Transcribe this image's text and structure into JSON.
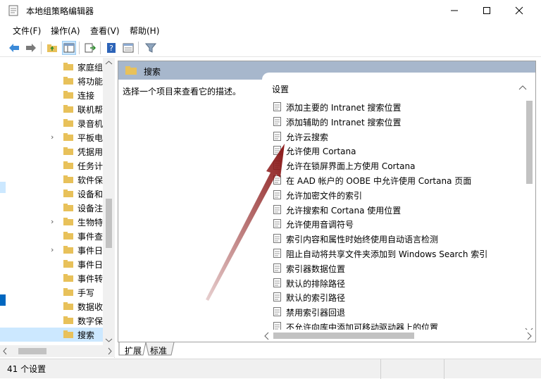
{
  "window": {
    "title": "本地组策略编辑器",
    "controls": {
      "minimize": "—",
      "maximize": "☐",
      "close": "✕"
    }
  },
  "menu": [
    "文件(F)",
    "操作(A)",
    "查看(V)",
    "帮助(H)"
  ],
  "tree": {
    "items": [
      {
        "label": "家庭组",
        "expandable": false
      },
      {
        "label": "将功能",
        "expandable": false
      },
      {
        "label": "连接",
        "expandable": false
      },
      {
        "label": "联机帮",
        "expandable": false
      },
      {
        "label": "录音机",
        "expandable": false
      },
      {
        "label": "平板电",
        "expandable": true
      },
      {
        "label": "凭据用",
        "expandable": false
      },
      {
        "label": "任务计",
        "expandable": false
      },
      {
        "label": "软件保",
        "expandable": false
      },
      {
        "label": "设备和",
        "expandable": false
      },
      {
        "label": "设备注",
        "expandable": false
      },
      {
        "label": "生物特",
        "expandable": true
      },
      {
        "label": "事件查",
        "expandable": false
      },
      {
        "label": "事件日",
        "expandable": true
      },
      {
        "label": "事件日",
        "expandable": false
      },
      {
        "label": "事件转",
        "expandable": false
      },
      {
        "label": "手写",
        "expandable": false
      },
      {
        "label": "数据收",
        "expandable": false
      },
      {
        "label": "数字保",
        "expandable": false
      },
      {
        "label": "搜索",
        "expandable": false,
        "selected": true
      }
    ]
  },
  "details": {
    "header": "搜索",
    "description": "选择一个项目来查看它的描述。",
    "column_header": "设置",
    "settings": [
      "添加主要的 Intranet 搜索位置",
      "添加辅助的 Intranet 搜索位置",
      "允许云搜索",
      "允许使用 Cortana",
      "允许在锁屏界面上方使用 Cortana",
      "在 AAD 帐户的 OOBE 中允许使用 Cortana 页面",
      "允许加密文件的索引",
      "允许搜索和 Cortana 使用位置",
      "允许使用音调符号",
      "索引内容和属性时始终使用自动语言检测",
      "阻止自动将共享文件夹添加到 Windows Search 索引",
      "索引器数据位置",
      "默认的排除路径",
      "默认的索引路径",
      "禁用索引器回退",
      "不允许向库中添加可移动驱动器上的位置"
    ]
  },
  "tabs": [
    "扩展",
    "标准"
  ],
  "status": "41 个设置",
  "colors": {
    "header_bg": "#a7b7cc",
    "selection": "#cce8ff",
    "arrow": "#8b1a1a",
    "folder": "#e8c15a"
  }
}
